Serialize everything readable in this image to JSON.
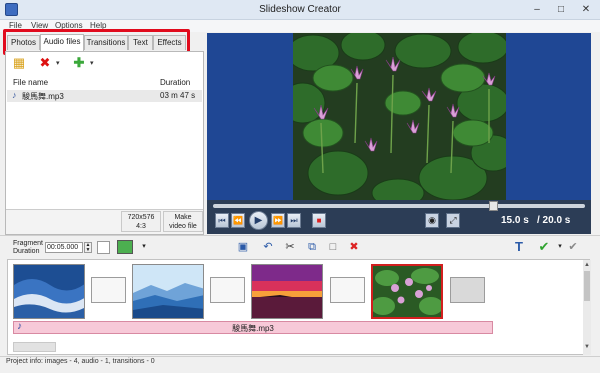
{
  "window": {
    "title": "Slideshow Creator",
    "min": "–",
    "max": "□",
    "close": "✕"
  },
  "menu": [
    "File",
    "View",
    "Options",
    "Help"
  ],
  "tabs": [
    "Photos",
    "Audio files",
    "Transitions",
    "Text",
    "Effects"
  ],
  "active_tab": "Audio files",
  "left_panel": {
    "columns": {
      "file": "File name",
      "duration": "Duration"
    },
    "rows": [
      {
        "file": "駿馬舞.mp3",
        "duration": "03 m 47 s"
      }
    ],
    "resolution": "720x576\n4:3",
    "make_video": "Make\nvideo file"
  },
  "player": {
    "current": "15.0 s",
    "total": "/ 20.0 s",
    "progress": 0.75
  },
  "fragment": {
    "label": "Fragment\nDuration",
    "value": "00:05.000"
  },
  "timeline": {
    "audio_file": "駿馬舞.mp3"
  },
  "status": {
    "text": "Project info: images - 4, audio - 1, transitions - 0"
  },
  "colors": {
    "accent_red": "#e10b1d",
    "preview_bg": "#1f4794",
    "player_bg": "#2c3d56",
    "audio_track": "#f7c9d8"
  },
  "icons": {
    "add": "add-files-icon",
    "delete": "delete-icon",
    "plus": "plus-icon",
    "save": "save-icon",
    "undo": "undo-icon",
    "cut": "cut-icon",
    "copy": "copy-icon",
    "paste": "paste-icon",
    "remove": "remove-icon",
    "text": "text-icon",
    "check": "check-icon",
    "tools": "tools-icon",
    "camera": "camera-icon",
    "fullscreen": "fullscreen-icon"
  }
}
